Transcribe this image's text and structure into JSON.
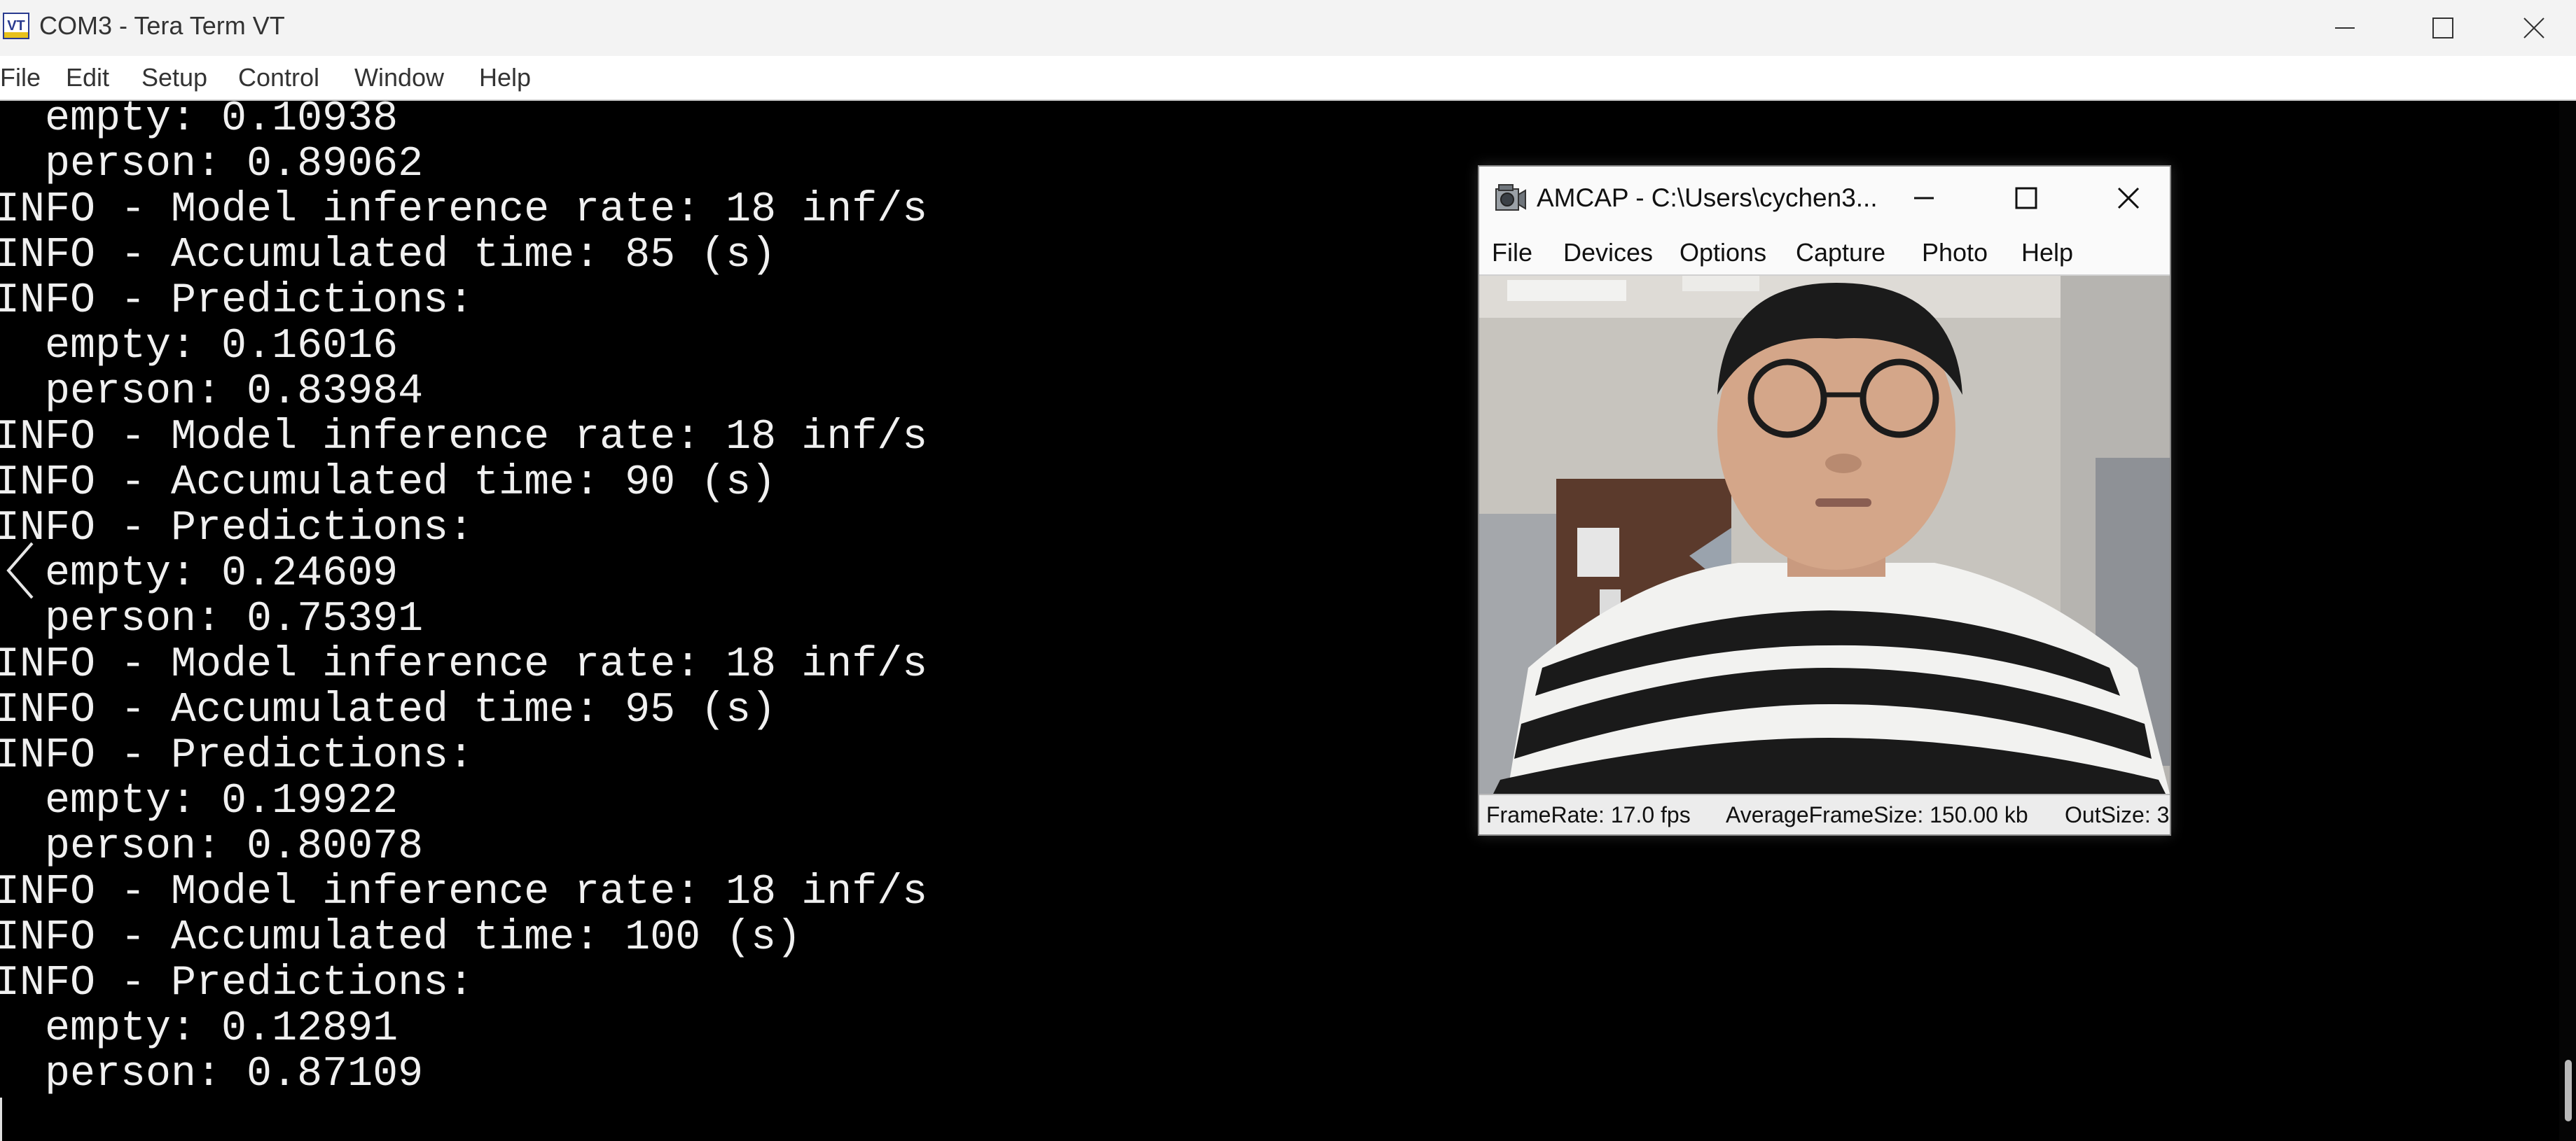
{
  "window": {
    "title": "COM3 - Tera Term VT",
    "icon_label": "VT",
    "controls": [
      "minimize-icon",
      "maximize-icon",
      "close-icon"
    ]
  },
  "menu": [
    "File",
    "Edit",
    "Setup",
    "Control",
    "Window",
    "Help"
  ],
  "terminal": {
    "lines": [
      "  empty: 0.10938",
      "  person: 0.89062",
      "INFO - Model inference rate: 18 inf/s",
      "INFO - Accumulated time: 85 (s)",
      "INFO - Predictions:",
      "  empty: 0.16016",
      "  person: 0.83984",
      "INFO - Model inference rate: 18 inf/s",
      "INFO - Accumulated time: 90 (s)",
      "INFO - Predictions:",
      "  empty: 0.24609",
      "  person: 0.75391",
      "INFO - Model inference rate: 18 inf/s",
      "INFO - Accumulated time: 95 (s)",
      "INFO - Predictions:",
      "  empty: 0.19922",
      "  person: 0.80078",
      "INFO - Model inference rate: 18 inf/s",
      "INFO - Accumulated time: 100 (s)",
      "INFO - Predictions:",
      "  empty: 0.12891",
      "  person: 0.87109"
    ]
  },
  "amcap": {
    "title": "AMCAP - C:\\Users\\cychen3...",
    "menu": [
      "File",
      "Devices",
      "Options",
      "Capture",
      "Photo",
      "Help"
    ],
    "status": {
      "framerate": "FrameRate: 17.0 fps",
      "avg_frame_size": "AverageFrameSize: 150.00 kb",
      "outsize": "OutSize: 3"
    }
  },
  "colors": {
    "terminal_bg": "#000000",
    "terminal_fg": "#f0f0f0",
    "titlebar_bg": "#f3f3f3"
  }
}
